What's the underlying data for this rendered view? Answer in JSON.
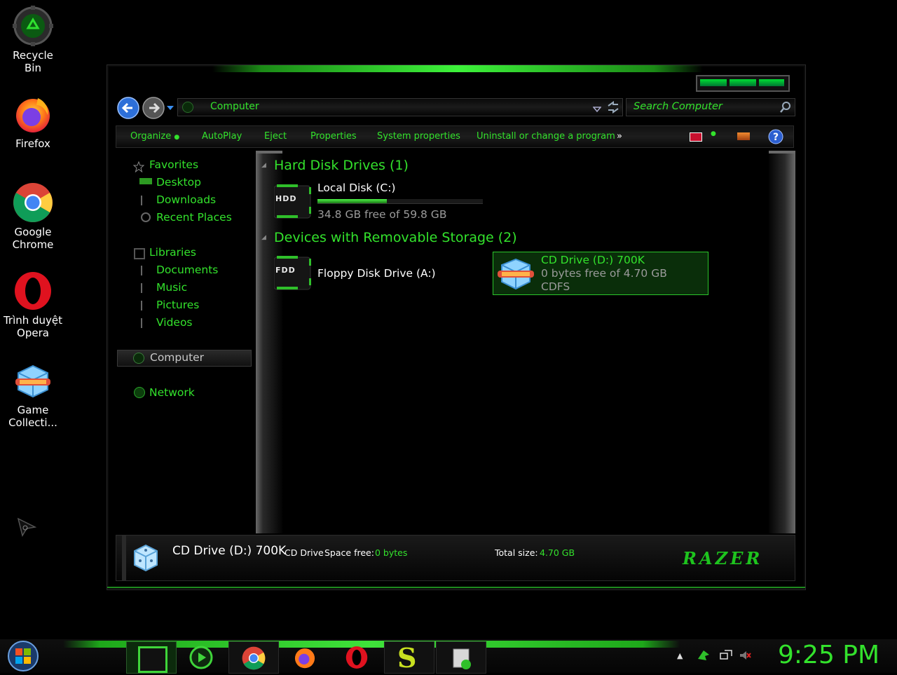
{
  "desktop": {
    "icons": [
      {
        "label": "Recycle Bin",
        "icon": "recycle-bin-icon"
      },
      {
        "label": "Firefox",
        "icon": "firefox-icon"
      },
      {
        "label": "Google\nChrome",
        "line1": "Google",
        "line2": "Chrome",
        "icon": "chrome-icon"
      },
      {
        "label": "Trình duyệt Opera",
        "line1": "Trình duyệt",
        "line2": "Opera",
        "icon": "opera-icon"
      },
      {
        "label": "Game Collecti...",
        "line1": "Game",
        "line2": "Collecti...",
        "icon": "game-collection-icon"
      }
    ]
  },
  "explorer": {
    "address": "Computer",
    "search_placeholder": "Search Computer",
    "toolbar": [
      "Organize",
      "AutoPlay",
      "Eject",
      "Properties",
      "System properties",
      "Uninstall or change a program"
    ],
    "toolbar_more": "»",
    "sidebar": {
      "favorites": "Favorites",
      "favorites_items": [
        "Desktop",
        "Downloads",
        "Recent Places"
      ],
      "libraries": "Libraries",
      "libraries_items": [
        "Documents",
        "Music",
        "Pictures",
        "Videos"
      ],
      "computer": "Computer",
      "network": "Network"
    },
    "groups": {
      "hdd_title": "Hard Disk Drives (1)",
      "removable_title": "Devices with Removable Storage (2)"
    },
    "drives": {
      "c": {
        "badge": "HDD",
        "name": "Local Disk (C:)",
        "free": "34.8 GB free of 59.8 GB",
        "used_fraction": 0.42
      },
      "a": {
        "badge": "FDD",
        "name": "Floppy Disk Drive (A:)"
      },
      "d": {
        "name": "CD Drive (D:) 700K",
        "free": "0 bytes free of 4.70 GB",
        "fs": "CDFS"
      }
    },
    "details": {
      "name": "CD Drive (D:) 700K",
      "type": "CD Drive",
      "space_free_label": "Space free:",
      "space_free_value": "0 bytes",
      "total_size_label": "Total size:",
      "total_size_value": "4.70 GB",
      "brand": "RAZER"
    }
  },
  "taskbar": {
    "clock": "9:25 PM",
    "tray_expand": "▲"
  },
  "colors": {
    "accent": "#33e22c",
    "background": "#000000",
    "selection": "#0f3a0f"
  }
}
